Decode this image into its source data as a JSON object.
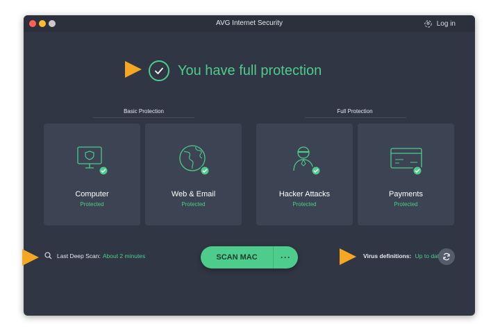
{
  "window": {
    "title": "AVG Internet Security",
    "login_label": "Log in"
  },
  "status": {
    "message": "You have full protection"
  },
  "groups": {
    "basic_label": "Basic Protection",
    "full_label": "Full Protection"
  },
  "tiles": [
    {
      "name": "Computer",
      "status": "Protected",
      "icon": "monitor-shield-icon"
    },
    {
      "name": "Web & Email",
      "status": "Protected",
      "icon": "globe-icon"
    },
    {
      "name": "Hacker Attacks",
      "status": "Protected",
      "icon": "hacker-icon"
    },
    {
      "name": "Payments",
      "status": "Protected",
      "icon": "credit-card-icon"
    }
  ],
  "scan": {
    "last_scan_label": "Last Deep Scan:",
    "last_scan_value": "About 2 minutes",
    "button_label": "SCAN MAC",
    "more_label": "···"
  },
  "virus": {
    "label": "Virus definitions:",
    "value": "Up to date"
  },
  "colors": {
    "accent": "#4ecc8c",
    "background": "#303644",
    "tile": "#3c4352",
    "annotation_arrow": "#f5a623"
  }
}
